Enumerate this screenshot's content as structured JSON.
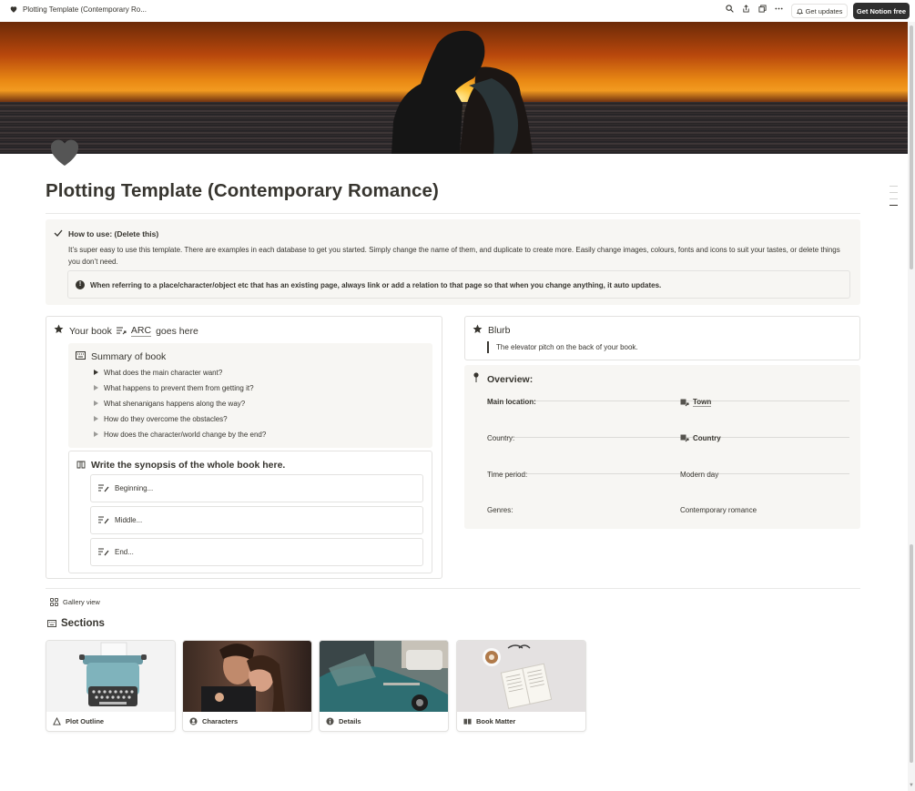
{
  "topbar": {
    "page_crumb": "Plotting Template (Contemporary Ro...",
    "get_updates_label": "Get updates",
    "get_notion_label": "Get Notion free"
  },
  "page": {
    "title": "Plotting Template (Contemporary Romance)",
    "icon": "heart-icon"
  },
  "howto": {
    "title": "How to use: (Delete this)",
    "body": "It’s super easy to use this template. There are examples in each database to get you started. Simply change the name of them, and duplicate to create more. Easily change images, colours, fonts and icons to suit your tastes, or delete things you don’t need.",
    "note": "When referring to a place/character/object etc that has an existing page, always link or add a relation to that page so that when you change anything, it auto updates."
  },
  "book": {
    "title_prefix": "Your book",
    "arc_label": "ARC",
    "title_suffix": "goes here",
    "summary_title": "Summary of book",
    "summary_items": [
      "What does the main character want?",
      "What happens to prevent them from getting it?",
      "What shenanigans happens along the way?",
      "How do they overcome the obstacles?",
      "How does the character/world change by the end?"
    ],
    "synopsis_title": "Write the synopsis of the whole book here.",
    "synopsis_items": [
      "Beginning...",
      "Middle...",
      "End..."
    ]
  },
  "blurb": {
    "title": "Blurb",
    "quote": "The elevator pitch on the back of your book."
  },
  "overview": {
    "title": "Overview:",
    "rows": [
      {
        "key": "Main location:",
        "value": "Town"
      },
      {
        "key": "Country:",
        "value": "Country"
      },
      {
        "key": "Time period:",
        "value": "Modern day"
      },
      {
        "key": "Genres:",
        "value": "Contemporary romance"
      }
    ]
  },
  "gallery": {
    "view_label": "Gallery view",
    "section_title": "Sections",
    "cards": [
      {
        "label": "Plot Outline",
        "icon": "triangle-icon"
      },
      {
        "label": "Characters",
        "icon": "person-circle-icon"
      },
      {
        "label": "Details",
        "icon": "info-circle-icon"
      },
      {
        "label": "Book Matter",
        "icon": "open-book-icon"
      }
    ]
  }
}
